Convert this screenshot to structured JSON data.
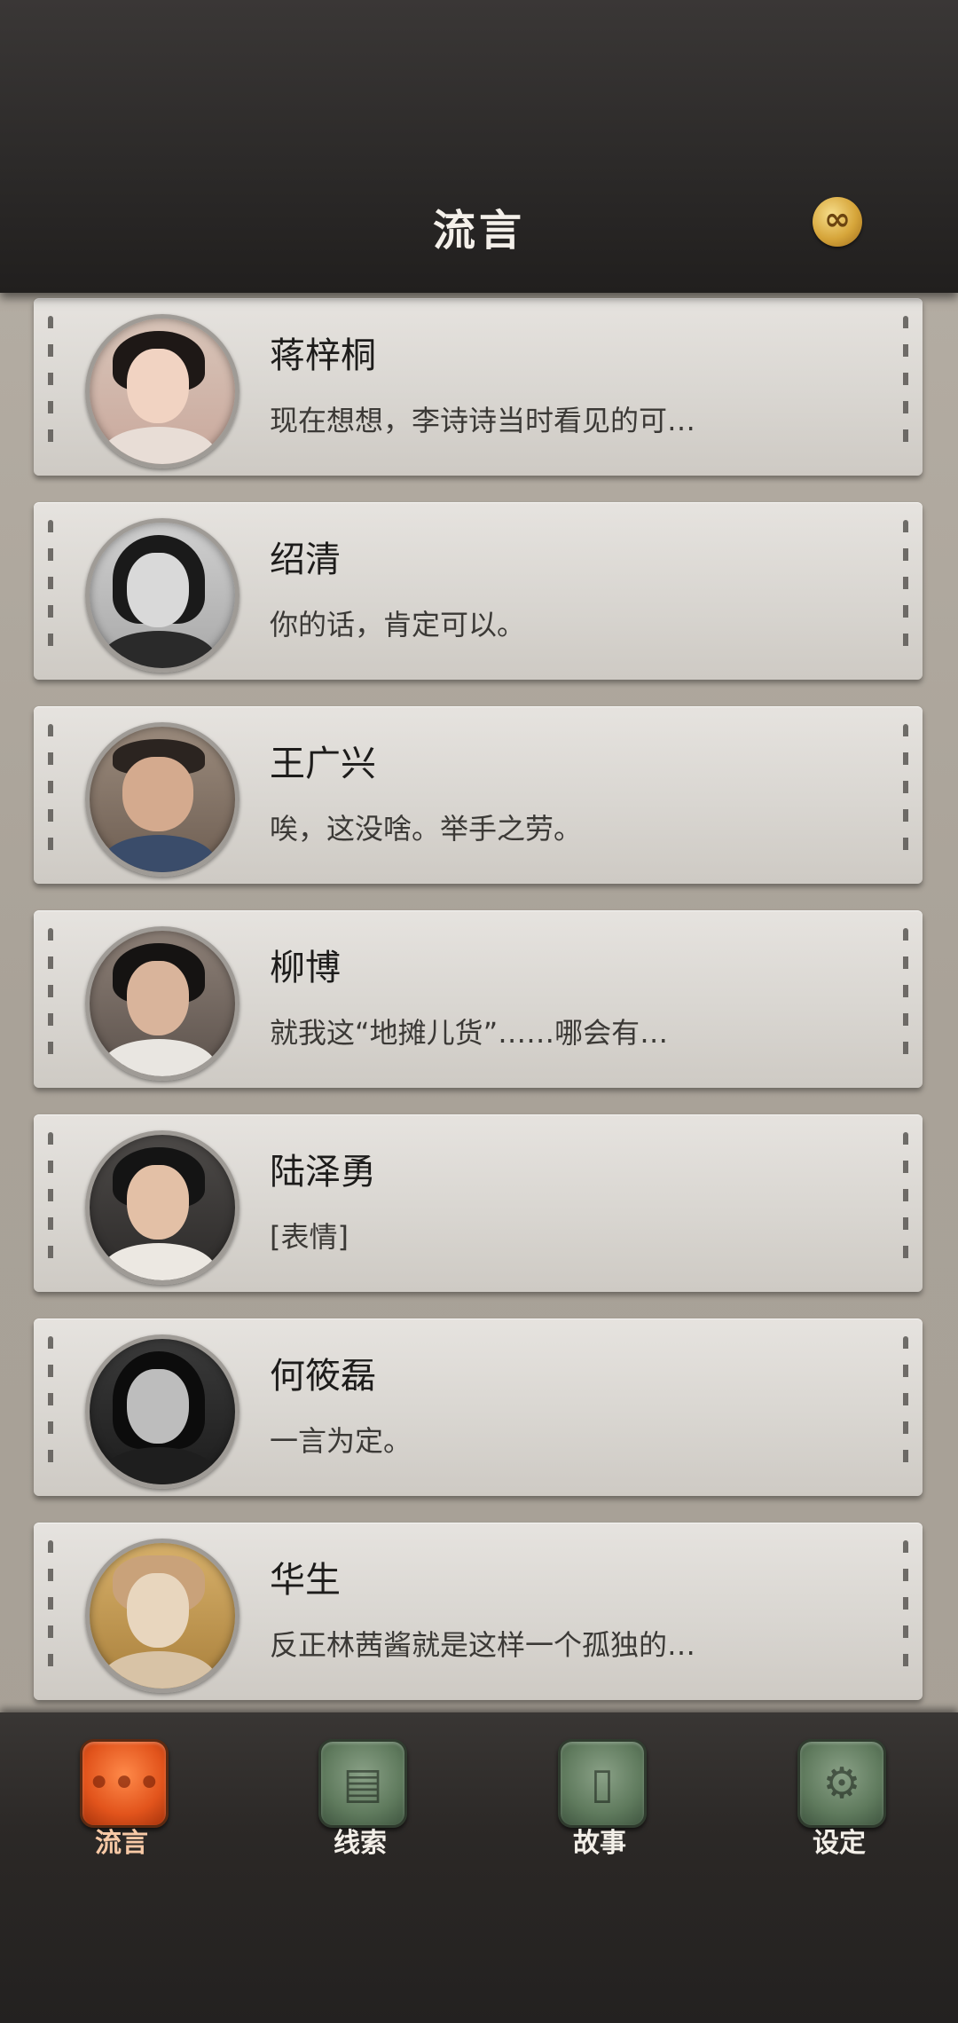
{
  "header": {
    "title": "流言",
    "currency_symbol": "∞",
    "currency_icon": "gold-coin-infinity-icon"
  },
  "conversations": [
    {
      "name": "蒋梓桐",
      "message": "现在想想，李诗诗当时看见的可…",
      "avatar_icon": "avatar-jiang-zitong"
    },
    {
      "name": "绍清",
      "message": "你的话，肯定可以。",
      "avatar_icon": "avatar-shao-qing"
    },
    {
      "name": "王广兴",
      "message": "唉，这没啥。举手之劳。",
      "avatar_icon": "avatar-wang-guangxing"
    },
    {
      "name": "柳博",
      "message": "就我这“地摊儿货”……哪会有…",
      "avatar_icon": "avatar-liu-bo"
    },
    {
      "name": "陆泽勇",
      "message": "[表情]",
      "avatar_icon": "avatar-lu-zeyong"
    },
    {
      "name": "何筱磊",
      "message": "一言为定。",
      "avatar_icon": "avatar-he-xiaolei"
    },
    {
      "name": "华生",
      "message": "反正林茜酱就是这样一个孤独的…",
      "avatar_icon": "avatar-huasheng-cat"
    }
  ],
  "nav": {
    "items": [
      {
        "label": "流言",
        "icon": "chat-bubbles-icon",
        "active": true
      },
      {
        "label": "线索",
        "icon": "document-icon",
        "active": false
      },
      {
        "label": "故事",
        "icon": "book-icon",
        "active": false
      },
      {
        "label": "设定",
        "icon": "gears-icon",
        "active": false
      }
    ]
  },
  "colors": {
    "active_tab": "#e2541c",
    "inactive_tab": "#5f7a5d",
    "header_bg": "#2b2928",
    "card_bg": "#dedbd6"
  }
}
